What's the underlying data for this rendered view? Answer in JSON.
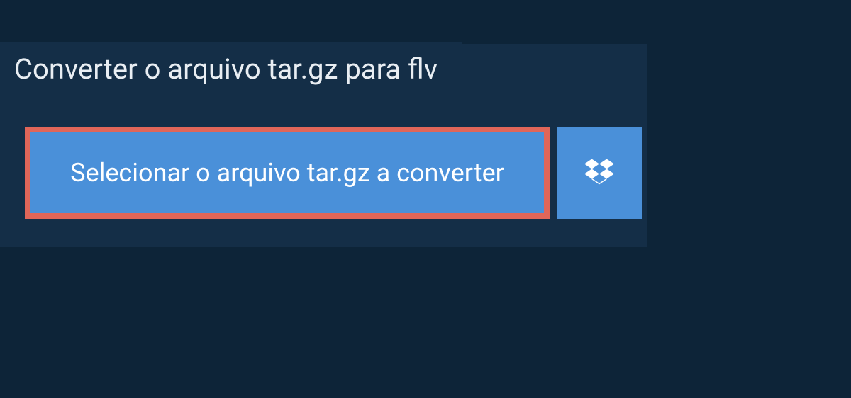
{
  "title": "Converter o arquivo tar.gz para flv",
  "select_button_label": "Selecionar o arquivo tar.gz a converter",
  "dropbox_icon": "dropbox-icon"
}
